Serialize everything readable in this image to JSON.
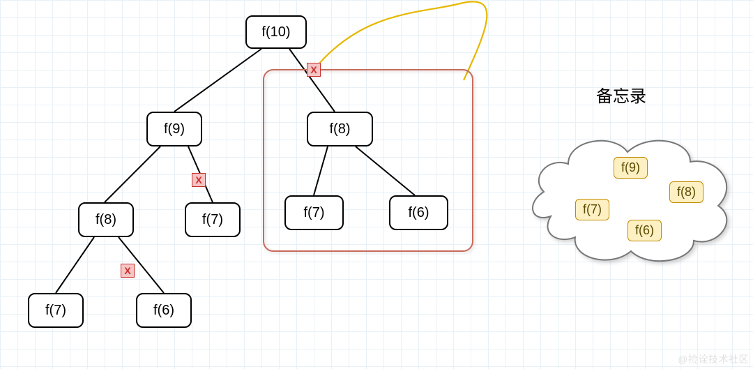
{
  "chart_data": {
    "type": "tree-diagram",
    "description": "Fibonacci recursion tree with memoization pruning",
    "root": {
      "label": "f(10)",
      "children": [
        {
          "label": "f(9)",
          "prune_marker_on_right_edge": true,
          "children": [
            {
              "label": "f(8)",
              "prune_marker_on_right_edge": true,
              "children": [
                {
                  "label": "f(7)"
                },
                {
                  "label": "f(6)"
                }
              ]
            },
            {
              "label": "f(7)"
            }
          ]
        },
        {
          "label": "f(8)",
          "highlighted_as_pruned_subtree": true,
          "prune_marker_on_incoming_edge": true,
          "children": [
            {
              "label": "f(7)"
            },
            {
              "label": "f(6)"
            }
          ]
        }
      ]
    },
    "memoization": {
      "title": "备忘录",
      "stored_values": [
        "f(9)",
        "f(8)",
        "f(7)",
        "f(6)"
      ]
    }
  },
  "nodes": {
    "n10": "f(10)",
    "n9": "f(9)",
    "n8r": "f(8)",
    "n8l": "f(8)",
    "n7a": "f(7)",
    "n7b": "f(7)",
    "n7c": "f(7)",
    "n6a": "f(6)",
    "n6b": "f(6)"
  },
  "prune_glyph": "X",
  "memo": {
    "title": "备忘录",
    "chips": {
      "c1": "f(9)",
      "c2": "f(8)",
      "c3": "f(7)",
      "c4": "f(6)"
    }
  },
  "watermark": "@捡诠技术社区"
}
